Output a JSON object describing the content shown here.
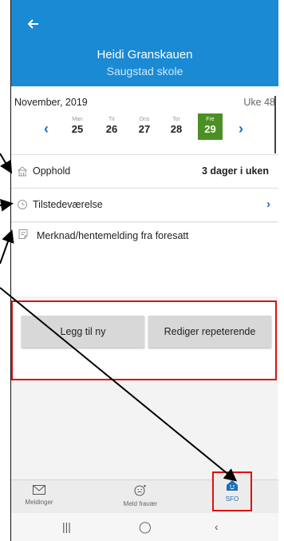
{
  "header": {
    "back_icon": "arrow-left-icon",
    "name": "Heidi Granskauen",
    "school": "Saugstad skole"
  },
  "calendar": {
    "month": "November, 2019",
    "week": "Uke 48",
    "prev_icon": "chevron-left-icon",
    "next_icon": "chevron-right-icon",
    "days": [
      {
        "name": "Man",
        "date": "25"
      },
      {
        "name": "Tir",
        "date": "26"
      },
      {
        "name": "Ons",
        "date": "27"
      },
      {
        "name": "Tor",
        "date": "28"
      },
      {
        "name": "Fre",
        "date": "29",
        "selected": true
      }
    ]
  },
  "rows": {
    "stay": {
      "label": "Opphold",
      "value": "3 dager i uken",
      "icon": "building-icon"
    },
    "presence": {
      "label": "Tilstedeværelse",
      "icon": "clock-icon"
    },
    "note": {
      "label": "Merknad/hentemelding fra foresatt",
      "icon": "note-icon"
    }
  },
  "actions": {
    "add_label": "Legg til ny",
    "edit_repeat_label": "Rediger repeterende"
  },
  "bottom_nav": {
    "messages": "Meldinger",
    "report_absence": "Meld fravær",
    "sfo": "SFO"
  },
  "colors": {
    "header_blue": "#1a8ad4",
    "selected_green": "#4c8f22",
    "highlight_red": "#dd1111"
  }
}
